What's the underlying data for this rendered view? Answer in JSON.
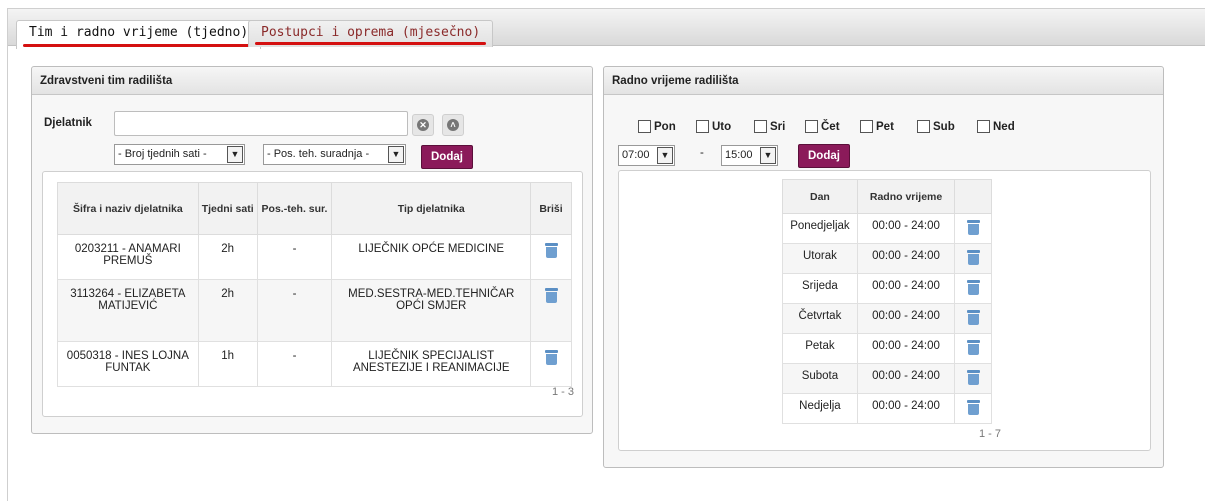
{
  "tabs": [
    {
      "label": "Tim i radno vrijeme (tjedno)",
      "active": true
    },
    {
      "label": "Postupci i oprema (mjesečno)",
      "active": false
    }
  ],
  "team_panel": {
    "title": "Zdravstveni tim radilišta",
    "employee_label": "Djelatnik",
    "employee_value": "",
    "hours_select": "- Broj tjednih sati -",
    "pos_select": "- Pos. teh. suradnja -",
    "add_label": "Dodaj",
    "columns": [
      "Šifra i naziv djelatnika",
      "Tjedni sati",
      "Pos.-teh. sur.",
      "Tip djelatnika",
      "Briši"
    ],
    "rows": [
      {
        "name": "0203211 - ANAMARI PREMUŠ",
        "hours": "2h",
        "pos": "-",
        "type": "LIJEČNIK OPĆE MEDICINE"
      },
      {
        "name": "3113264 - ELIZABETA MATIJEVIĆ",
        "hours": "2h",
        "pos": "-",
        "type": "MED.SESTRA-MED.TEHNIČAR OPĆI SMJER"
      },
      {
        "name": "0050318 - INES LOJNA FUNTAK",
        "hours": "1h",
        "pos": "-",
        "type": "LIJEČNIK SPECIJALIST ANESTEZIJE I REANIMACIJE"
      }
    ],
    "pager": "1 - 3"
  },
  "hours_panel": {
    "title": "Radno vrijeme radilišta",
    "days": [
      "Pon",
      "Uto",
      "Sri",
      "Čet",
      "Pet",
      "Sub",
      "Ned"
    ],
    "from_time": "07:00",
    "dash": "-",
    "to_time": "15:00",
    "add_label": "Dodaj",
    "columns": [
      "Dan",
      "Radno vrijeme"
    ],
    "rows": [
      {
        "day": "Ponedjeljak",
        "time": "00:00 - 24:00"
      },
      {
        "day": "Utorak",
        "time": "00:00 - 24:00"
      },
      {
        "day": "Srijeda",
        "time": "00:00 - 24:00"
      },
      {
        "day": "Četvrtak",
        "time": "00:00 - 24:00"
      },
      {
        "day": "Petak",
        "time": "00:00 - 24:00"
      },
      {
        "day": "Subota",
        "time": "00:00 - 24:00"
      },
      {
        "day": "Nedjelja",
        "time": "00:00 - 24:00"
      }
    ],
    "pager": "1 - 7"
  },
  "colors": {
    "accent": "#8b1a5a",
    "tab_underline": "#d41010",
    "trash": "#6f9fd0"
  }
}
